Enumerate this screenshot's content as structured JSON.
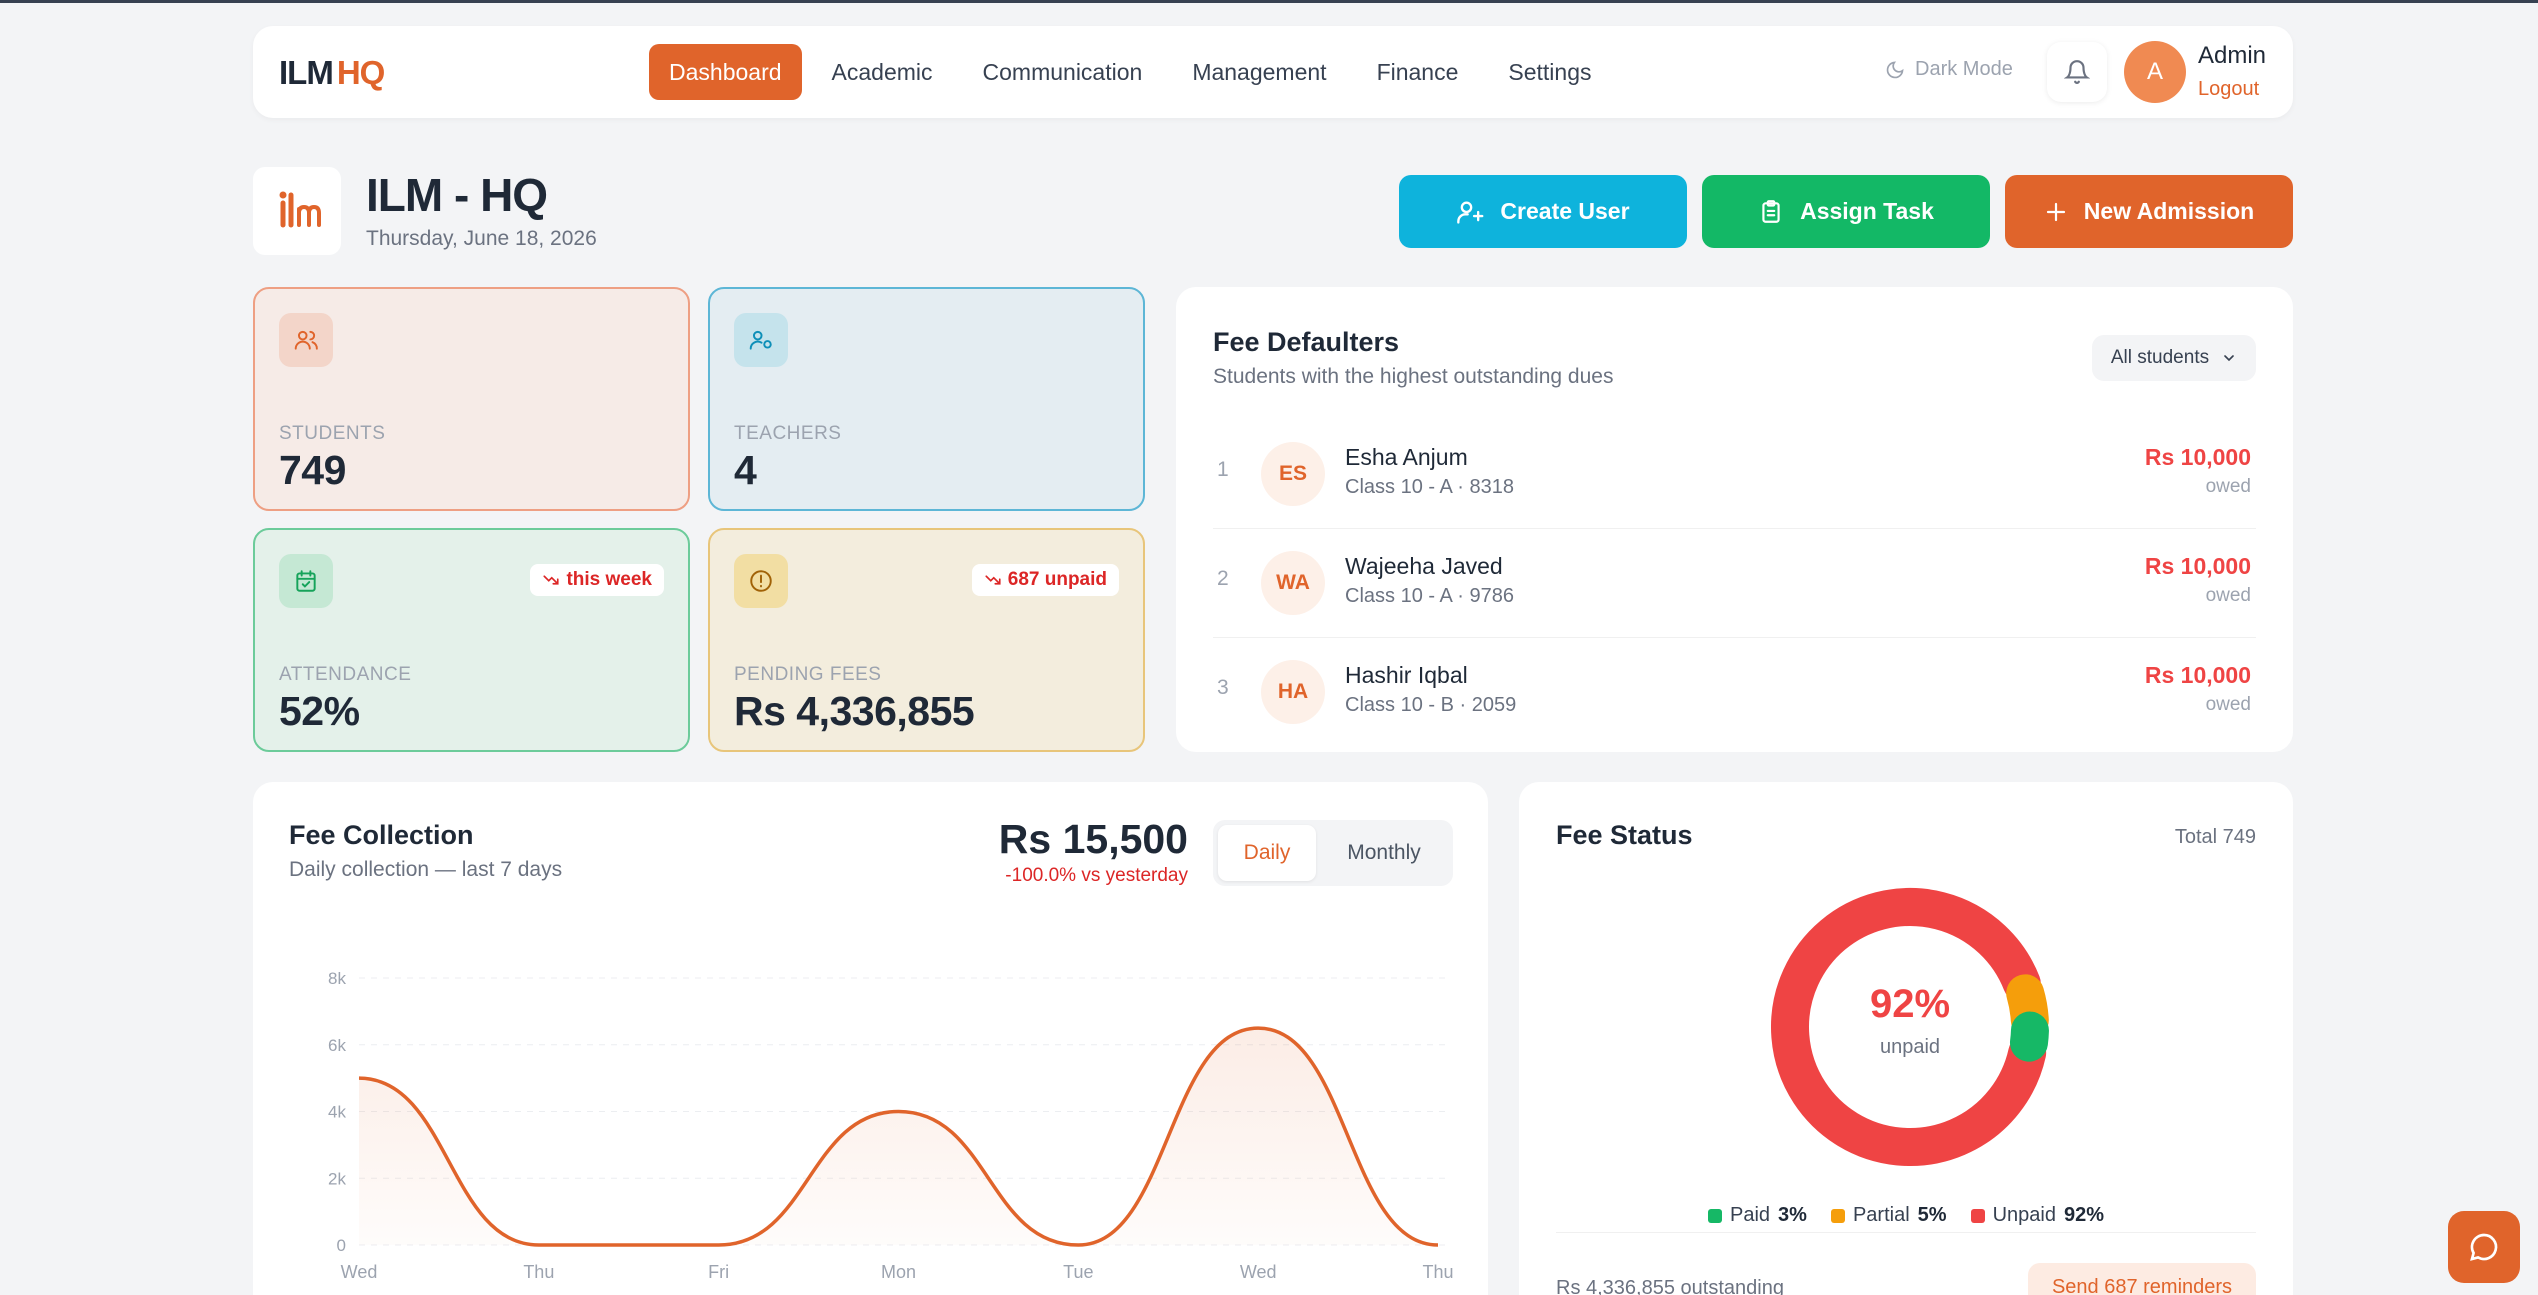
{
  "app": {
    "logo_left": "ILM",
    "logo_right": "HQ"
  },
  "nav": {
    "items": [
      {
        "label": "Dashboard",
        "active": true
      },
      {
        "label": "Academic"
      },
      {
        "label": "Communication"
      },
      {
        "label": "Management"
      },
      {
        "label": "Finance"
      },
      {
        "label": "Settings"
      }
    ],
    "dark_mode": "Dark Mode",
    "user_initial": "A",
    "user_name": "Admin",
    "logout": "Logout"
  },
  "header": {
    "title": "ILM - HQ",
    "date": "Thursday, June 18, 2026",
    "actions": {
      "create_user": "Create User",
      "assign_task": "Assign Task",
      "new_admission": "New Admission"
    }
  },
  "stats": {
    "students": {
      "label": "STUDENTS",
      "value": "749"
    },
    "teachers": {
      "label": "TEACHERS",
      "value": "4"
    },
    "attendance": {
      "label": "ATTENDANCE",
      "value": "52%",
      "badge": "this week"
    },
    "pending": {
      "label": "PENDING FEES",
      "value": "Rs 4,336,855",
      "badge": "687 unpaid"
    }
  },
  "defaulters": {
    "title": "Fee Defaulters",
    "subtitle": "Students with the highest outstanding dues",
    "filter": "All students",
    "rows": [
      {
        "num": "1",
        "initials": "ES",
        "name": "Esha Anjum",
        "class": "Class 10 - A · 8318",
        "amount": "Rs 10,000",
        "owed": "owed"
      },
      {
        "num": "2",
        "initials": "WA",
        "name": "Wajeeha Javed",
        "class": "Class 10 - A · 9786",
        "amount": "Rs 10,000",
        "owed": "owed"
      },
      {
        "num": "3",
        "initials": "HA",
        "name": "Hashir Iqbal",
        "class": "Class 10 - B · 2059",
        "amount": "Rs 10,000",
        "owed": "owed"
      }
    ]
  },
  "collection": {
    "title": "Fee Collection",
    "subtitle": "Daily collection — last 7 days",
    "amount": "Rs 15,500",
    "change": "-100.0% vs yesterday",
    "toggle": {
      "daily": "Daily",
      "monthly": "Monthly"
    },
    "accent": "#e0642b"
  },
  "chart_data": {
    "type": "area",
    "categories": [
      "Wed",
      "Thu",
      "Fri",
      "Mon",
      "Tue",
      "Wed",
      "Thu"
    ],
    "values": [
      5000,
      0,
      0,
      4000,
      0,
      6500,
      0
    ],
    "ylim": [
      0,
      8000
    ],
    "yticks": [
      "0",
      "2k",
      "4k",
      "6k",
      "8k"
    ],
    "title": "",
    "xlabel": "",
    "ylabel": "",
    "grid": true
  },
  "status": {
    "title": "Fee Status",
    "total": "Total 749",
    "center_pct": "92%",
    "center_label": "unpaid",
    "legend": [
      {
        "name": "Paid",
        "pct": "3%",
        "value": 3,
        "color": "#16b866"
      },
      {
        "name": "Partial",
        "pct": "5%",
        "value": 5,
        "color": "#f59e0b"
      },
      {
        "name": "Unpaid",
        "pct": "92%",
        "value": 92,
        "color": "#ef4444"
      }
    ],
    "outstanding": "Rs 4,336,855 outstanding",
    "remind": "Send 687 reminders"
  }
}
